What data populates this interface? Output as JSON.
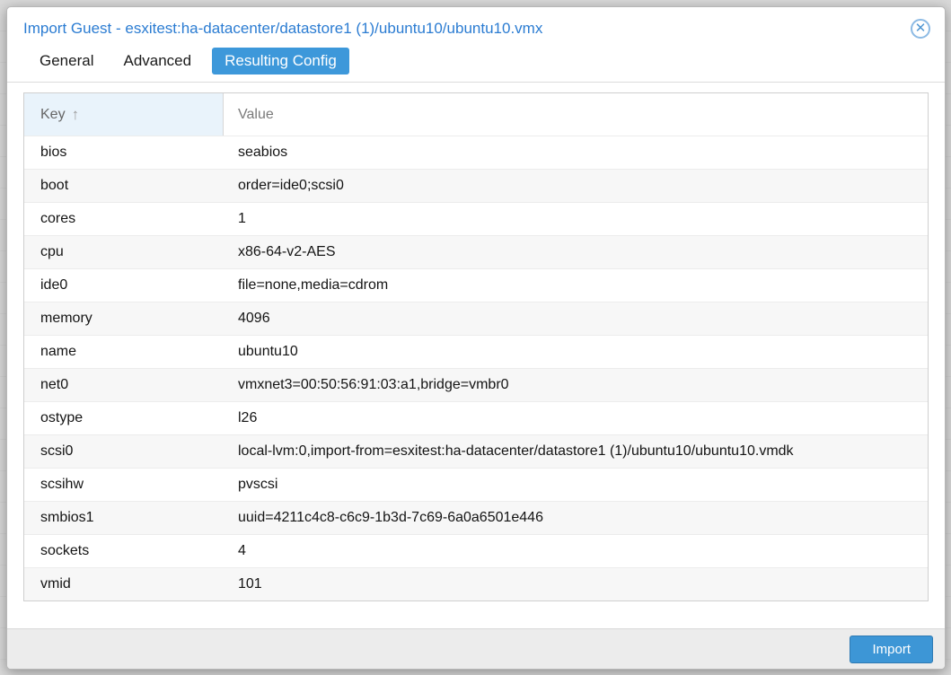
{
  "window": {
    "title": "Import Guest - esxitest:ha-datacenter/datastore1 (1)/ubuntu10/ubuntu10.vmx",
    "tabs": [
      {
        "label": "General",
        "active": false
      },
      {
        "label": "Advanced",
        "active": false
      },
      {
        "label": "Resulting Config",
        "active": true
      }
    ],
    "footer": {
      "import_button": "Import"
    }
  },
  "table": {
    "columns": [
      {
        "label": "Key",
        "sorted": "ascending",
        "sort_icon": "↑"
      },
      {
        "label": "Value",
        "sorted": null
      }
    ],
    "rows": [
      {
        "key": "bios",
        "value": "seabios"
      },
      {
        "key": "boot",
        "value": "order=ide0;scsi0"
      },
      {
        "key": "cores",
        "value": "1"
      },
      {
        "key": "cpu",
        "value": "x86-64-v2-AES"
      },
      {
        "key": "ide0",
        "value": "file=none,media=cdrom"
      },
      {
        "key": "memory",
        "value": "4096"
      },
      {
        "key": "name",
        "value": "ubuntu10"
      },
      {
        "key": "net0",
        "value": "vmxnet3=00:50:56:91:03:a1,bridge=vmbr0"
      },
      {
        "key": "ostype",
        "value": "l26"
      },
      {
        "key": "scsi0",
        "value": "local-lvm:0,import-from=esxitest:ha-datacenter/datastore1 (1)/ubuntu10/ubuntu10.vmdk"
      },
      {
        "key": "scsihw",
        "value": "pvscsi"
      },
      {
        "key": "smbios1",
        "value": "uuid=4211c4c8-c6c9-1b3d-7c69-6a0a6501e446"
      },
      {
        "key": "sockets",
        "value": "4"
      },
      {
        "key": "vmid",
        "value": "101"
      }
    ]
  },
  "icons": {
    "close": "circled-x",
    "sort_ascending": "up-arrow"
  },
  "colors": {
    "accent_blue": "#3d96d6",
    "active_tab_blue": "#3d98da",
    "title_blue": "#2b7cd2",
    "sorted_column_bg": "#e9f3fb",
    "row_stripe": "#f7f7f7",
    "footer_bg": "#ececec"
  }
}
